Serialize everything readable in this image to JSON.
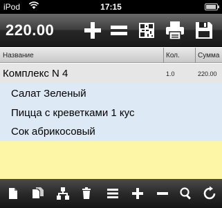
{
  "status_bar": {
    "carrier": "iPod",
    "time": "17:15",
    "wifi_icon": "wifi-icon",
    "battery_icon": "battery-icon"
  },
  "toolbar": {
    "total": "220.00",
    "buttons": [
      "add-icon",
      "equals-icon",
      "qr-code-icon",
      "printer-icon",
      "save-icon"
    ]
  },
  "table": {
    "headers": {
      "name": "Название",
      "qty": "Кол.",
      "sum": "Сумма"
    },
    "group": {
      "name": "Комплекс N 4",
      "qty": "1.0",
      "sum": "220.00"
    },
    "items": [
      "Салат Зеленый",
      "Пицца с креветками 1 кус",
      "Сок абрикосовый"
    ]
  },
  "bottom_toolbar": {
    "buttons": [
      "new-document-icon",
      "copy-document-icon",
      "tree-icon",
      "trash-icon",
      "list-icon",
      "plus-icon",
      "minus-icon",
      "search-icon",
      "refresh-icon"
    ]
  },
  "colors": {
    "items_background": "#dde9f5",
    "empty_area_background": "#fdf6a6",
    "group_background": "#e6e6e6"
  }
}
